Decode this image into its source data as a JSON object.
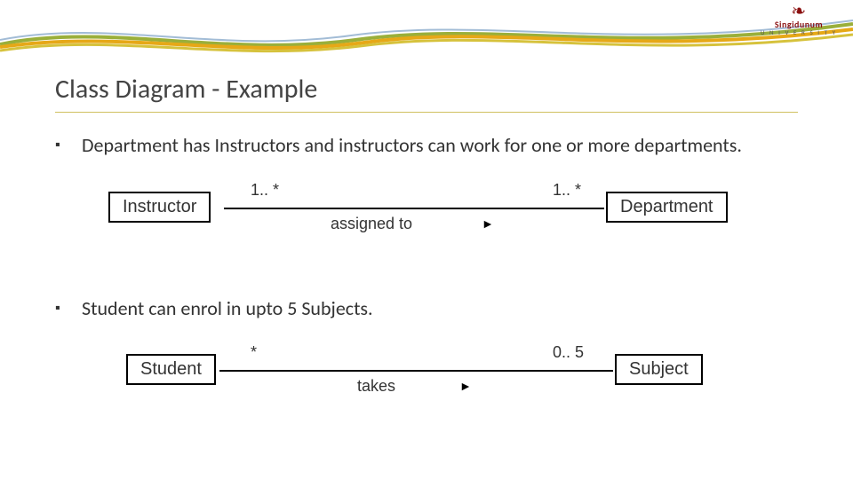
{
  "branding": {
    "university": "Singidunum",
    "subtitle": "U N I V E R S I T Y"
  },
  "title": "Class Diagram - Example",
  "bullets": [
    "Department has Instructors and instructors can work for one or more departments.",
    "Student can enrol in upto 5 Subjects."
  ],
  "diagrams": [
    {
      "left_class": "Instructor",
      "right_class": "Department",
      "left_mult": "1.. *",
      "right_mult": "1.. *",
      "label": "assigned to",
      "direction": "►"
    },
    {
      "left_class": "Student",
      "right_class": "Subject",
      "left_mult": "*",
      "right_mult": "0.. 5",
      "label": "takes",
      "direction": "►"
    }
  ]
}
